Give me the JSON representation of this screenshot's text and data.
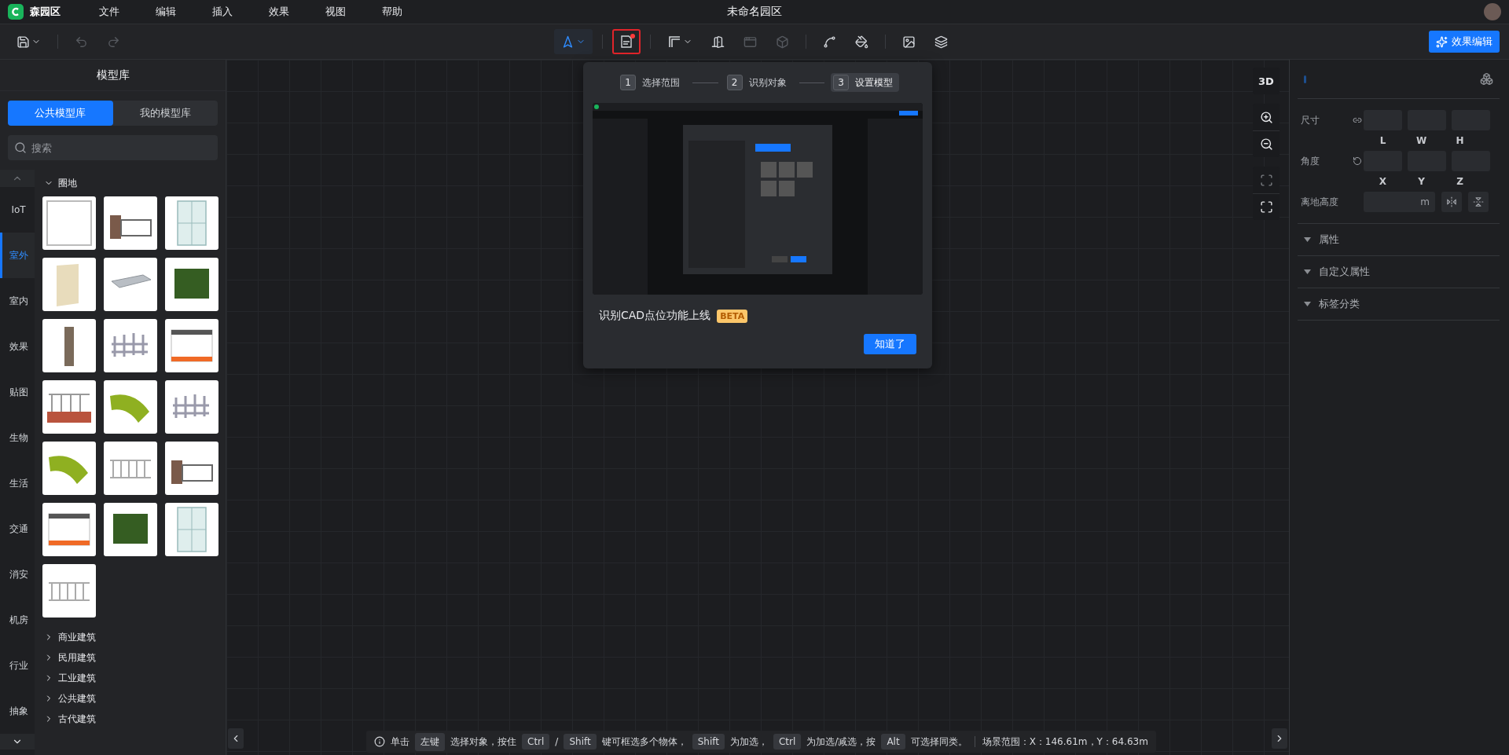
{
  "menubar": {
    "app_name": "森园区",
    "menus": [
      "文件",
      "编辑",
      "插入",
      "效果",
      "视图",
      "帮助"
    ],
    "title": "未命名园区"
  },
  "toolbar": {
    "left_tools": [
      {
        "kind": "save",
        "caret": true,
        "disabled": false
      },
      {
        "kind": "divider"
      },
      {
        "kind": "undo",
        "caret": false,
        "disabled": true
      },
      {
        "kind": "redo",
        "caret": false,
        "disabled": true
      }
    ],
    "center_tools": [
      {
        "kind": "select",
        "caret": true,
        "disabled": false,
        "selected": true
      },
      {
        "kind": "divider"
      },
      {
        "kind": "cad",
        "caret": false,
        "disabled": false,
        "selected": false,
        "badge": true,
        "highlighted": true
      },
      {
        "kind": "divider"
      },
      {
        "kind": "wall",
        "caret": true,
        "disabled": false,
        "selected": false
      },
      {
        "kind": "door",
        "caret": false,
        "disabled": false,
        "selected": false
      },
      {
        "kind": "window",
        "caret": false,
        "disabled": true,
        "selected": false
      },
      {
        "kind": "cube",
        "caret": false,
        "disabled": true,
        "selected": false
      },
      {
        "kind": "divider"
      },
      {
        "kind": "path",
        "caret": false,
        "disabled": false,
        "selected": false
      },
      {
        "kind": "bucket",
        "caret": false,
        "disabled": false,
        "selected": false
      },
      {
        "kind": "divider"
      },
      {
        "kind": "image",
        "caret": false,
        "disabled": false,
        "selected": false
      },
      {
        "kind": "layers",
        "caret": false,
        "disabled": false,
        "selected": false
      }
    ],
    "effects_button": "效果编辑"
  },
  "library": {
    "title": "模型库",
    "tabs": [
      {
        "label": "公共模型库",
        "selected": true
      },
      {
        "label": "我的模型库",
        "selected": false
      }
    ],
    "search_placeholder": "搜索",
    "categories": [
      {
        "label": "IoT",
        "selected": false
      },
      {
        "label": "室外",
        "selected": true
      },
      {
        "label": "室内",
        "selected": false
      },
      {
        "label": "效果",
        "selected": false
      },
      {
        "label": "贴图",
        "selected": false
      },
      {
        "label": "生物",
        "selected": false
      },
      {
        "label": "生活",
        "selected": false
      },
      {
        "label": "交通",
        "selected": false
      },
      {
        "label": "消安",
        "selected": false
      },
      {
        "label": "机房",
        "selected": false
      },
      {
        "label": "行业",
        "selected": false
      },
      {
        "label": "抽象",
        "selected": false
      }
    ],
    "groups": [
      {
        "label": "圈地",
        "expanded": true,
        "thumbnails": [
          {
            "kind": "frame"
          },
          {
            "kind": "gate"
          },
          {
            "kind": "glass"
          },
          {
            "kind": "panel"
          },
          {
            "kind": "beam"
          },
          {
            "kind": "hedge"
          },
          {
            "kind": "post"
          },
          {
            "kind": "picket"
          },
          {
            "kind": "wall"
          },
          {
            "kind": "brick"
          },
          {
            "kind": "curve"
          },
          {
            "kind": "picket"
          },
          {
            "kind": "curve"
          },
          {
            "kind": "railing"
          },
          {
            "kind": "gate"
          },
          {
            "kind": "wall"
          },
          {
            "kind": "hedge"
          },
          {
            "kind": "glass"
          },
          {
            "kind": "railing"
          }
        ]
      },
      {
        "label": "商业建筑",
        "expanded": false
      },
      {
        "label": "民用建筑",
        "expanded": false
      },
      {
        "label": "工业建筑",
        "expanded": false
      },
      {
        "label": "公共建筑",
        "expanded": false
      },
      {
        "label": "古代建筑",
        "expanded": false
      }
    ]
  },
  "cad_popup": {
    "steps": [
      {
        "number": "1",
        "label": "选择范围",
        "selected": false
      },
      {
        "number": "2",
        "label": "识别对象",
        "selected": false
      },
      {
        "number": "3",
        "label": "设置模型",
        "selected": true
      }
    ],
    "headline": "识别CAD点位功能上线",
    "badge": "BETA",
    "button": "知道了"
  },
  "view_tools": {
    "mode_label": "3D",
    "tools": [
      {
        "kind": "zoom-in",
        "disabled": false
      },
      {
        "kind": "zoom-out",
        "disabled": false
      },
      {
        "kind": "focus",
        "disabled": true
      },
      {
        "kind": "fullscreen",
        "disabled": false
      }
    ]
  },
  "properties": {
    "size": {
      "label": "尺寸",
      "axes": [
        "L",
        "W",
        "H"
      ]
    },
    "rotation": {
      "label": "角度",
      "axes": [
        "X",
        "Y",
        "Z"
      ]
    },
    "elevation": {
      "label": "离地高度",
      "unit": "m"
    },
    "sections": [
      "属性",
      "自定义属性",
      "标签分类"
    ]
  },
  "status_bar": {
    "hint": [
      {
        "kind": "text",
        "text": "单击"
      },
      {
        "kind": "key",
        "text": "左键"
      },
      {
        "kind": "text",
        "text": "选择对象，按住"
      },
      {
        "kind": "key",
        "text": "Ctrl"
      },
      {
        "kind": "text",
        "text": "/"
      },
      {
        "kind": "key",
        "text": "Shift"
      },
      {
        "kind": "text",
        "text": "键可框选多个物体，"
      },
      {
        "kind": "key",
        "text": "Shift"
      },
      {
        "kind": "text",
        "text": "为加选，"
      },
      {
        "kind": "key",
        "text": "Ctrl"
      },
      {
        "kind": "text",
        "text": "为加选/减选，按"
      },
      {
        "kind": "key",
        "text": "Alt"
      },
      {
        "kind": "text",
        "text": "可选择同类。"
      }
    ],
    "scene_range": "场景范围：X：146.61m，Y：64.63m"
  }
}
